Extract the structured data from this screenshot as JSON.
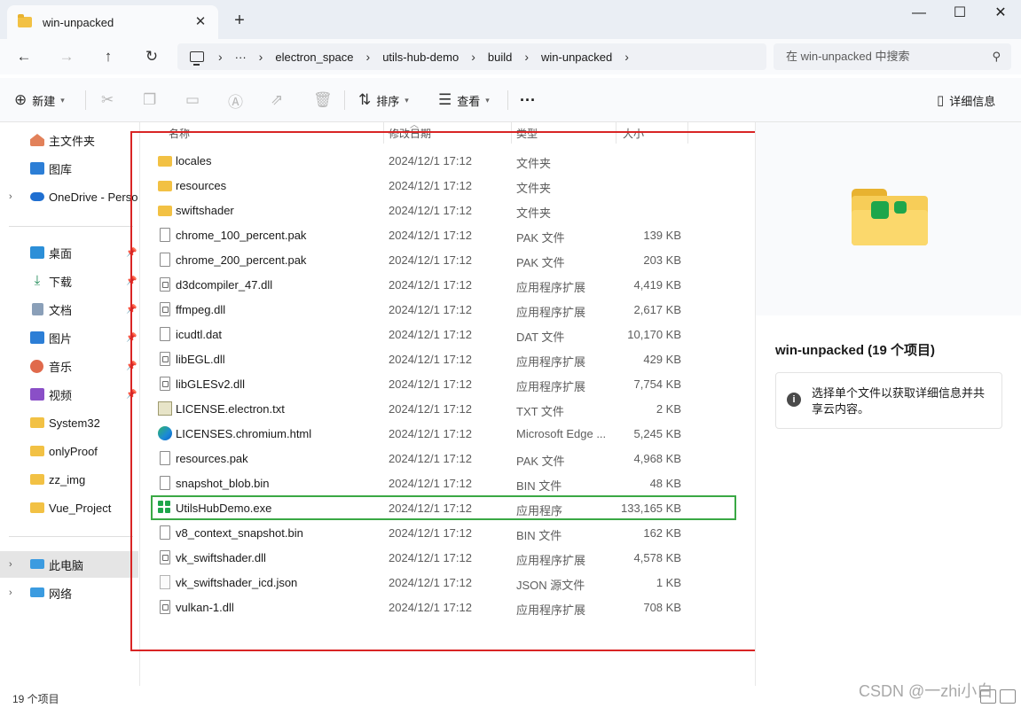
{
  "window": {
    "tab_title": "win-unpacked",
    "new_tab_label": "+",
    "tab_close_label": "✕",
    "minimize_label": "—",
    "maximize_label": "☐",
    "close_label": "✕"
  },
  "nav": {
    "back_label": "←",
    "forward_label": "→",
    "up_label": "↑",
    "refresh_label": "↻",
    "overflow_label": "···",
    "breadcrumbs": [
      "electron_space",
      "utils-hub-demo",
      "build",
      "win-unpacked"
    ],
    "search_placeholder": "在 win-unpacked 中搜索",
    "search_icon": "⚲"
  },
  "toolbar": {
    "new_label": "新建",
    "sort_label": "排序",
    "view_label": "查看",
    "more_label": "···",
    "details_label": "详细信息"
  },
  "sidebar": {
    "items": [
      {
        "label": "主文件夹",
        "icon": "home-icon"
      },
      {
        "label": "图库",
        "icon": "gallery-icon"
      },
      {
        "label": "OneDrive - Perso",
        "icon": "onedrive-icon"
      },
      {
        "label": "桌面",
        "icon": "desktop-icon"
      },
      {
        "label": "下载",
        "icon": "download-icon"
      },
      {
        "label": "文档",
        "icon": "documents-icon"
      },
      {
        "label": "图片",
        "icon": "pictures-icon"
      },
      {
        "label": "音乐",
        "icon": "music-icon"
      },
      {
        "label": "视频",
        "icon": "videos-icon"
      },
      {
        "label": "System32",
        "icon": "folder-icon"
      },
      {
        "label": "onlyProof",
        "icon": "folder-icon"
      },
      {
        "label": "zz_img",
        "icon": "folder-icon"
      },
      {
        "label": "Vue_Project",
        "icon": "folder-icon"
      },
      {
        "label": "此电脑",
        "icon": "this-pc-icon"
      },
      {
        "label": "网络",
        "icon": "network-icon"
      }
    ]
  },
  "columns": {
    "name": "名称",
    "modified": "修改日期",
    "type": "类型",
    "size": "大小"
  },
  "files": [
    {
      "name": "locales",
      "date": "2024/12/1 17:12",
      "type": "文件夹",
      "size": "",
      "icon": "folder"
    },
    {
      "name": "resources",
      "date": "2024/12/1 17:12",
      "type": "文件夹",
      "size": "",
      "icon": "folder"
    },
    {
      "name": "swiftshader",
      "date": "2024/12/1 17:12",
      "type": "文件夹",
      "size": "",
      "icon": "folder"
    },
    {
      "name": "chrome_100_percent.pak",
      "date": "2024/12/1 17:12",
      "type": "PAK 文件",
      "size": "139 KB",
      "icon": "file"
    },
    {
      "name": "chrome_200_percent.pak",
      "date": "2024/12/1 17:12",
      "type": "PAK 文件",
      "size": "203 KB",
      "icon": "file"
    },
    {
      "name": "d3dcompiler_47.dll",
      "date": "2024/12/1 17:12",
      "type": "应用程序扩展",
      "size": "4,419 KB",
      "icon": "dll"
    },
    {
      "name": "ffmpeg.dll",
      "date": "2024/12/1 17:12",
      "type": "应用程序扩展",
      "size": "2,617 KB",
      "icon": "dll"
    },
    {
      "name": "icudtl.dat",
      "date": "2024/12/1 17:12",
      "type": "DAT 文件",
      "size": "10,170 KB",
      "icon": "file"
    },
    {
      "name": "libEGL.dll",
      "date": "2024/12/1 17:12",
      "type": "应用程序扩展",
      "size": "429 KB",
      "icon": "dll"
    },
    {
      "name": "libGLESv2.dll",
      "date": "2024/12/1 17:12",
      "type": "应用程序扩展",
      "size": "7,754 KB",
      "icon": "dll"
    },
    {
      "name": "LICENSE.electron.txt",
      "date": "2024/12/1 17:12",
      "type": "TXT 文件",
      "size": "2 KB",
      "icon": "txt"
    },
    {
      "name": "LICENSES.chromium.html",
      "date": "2024/12/1 17:12",
      "type": "Microsoft Edge ...",
      "size": "5,245 KB",
      "icon": "edge"
    },
    {
      "name": "resources.pak",
      "date": "2024/12/1 17:12",
      "type": "PAK 文件",
      "size": "4,968 KB",
      "icon": "file"
    },
    {
      "name": "snapshot_blob.bin",
      "date": "2024/12/1 17:12",
      "type": "BIN 文件",
      "size": "48 KB",
      "icon": "file"
    },
    {
      "name": "UtilsHubDemo.exe",
      "date": "2024/12/1 17:12",
      "type": "应用程序",
      "size": "133,165 KB",
      "icon": "app"
    },
    {
      "name": "v8_context_snapshot.bin",
      "date": "2024/12/1 17:12",
      "type": "BIN 文件",
      "size": "162 KB",
      "icon": "file"
    },
    {
      "name": "vk_swiftshader.dll",
      "date": "2024/12/1 17:12",
      "type": "应用程序扩展",
      "size": "4,578 KB",
      "icon": "dll"
    },
    {
      "name": "vk_swiftshader_icd.json",
      "date": "2024/12/1 17:12",
      "type": "JSON 源文件",
      "size": "1 KB",
      "icon": "json"
    },
    {
      "name": "vulkan-1.dll",
      "date": "2024/12/1 17:12",
      "type": "应用程序扩展",
      "size": "708 KB",
      "icon": "dll"
    }
  ],
  "details": {
    "title": "win-unpacked (19 个项目)",
    "info_text": "选择单个文件以获取详细信息并共享云内容。"
  },
  "status": {
    "item_count": "19 个项目"
  },
  "watermark": "CSDN @一zhi小白",
  "colors": {
    "annotation_red": "#d92525",
    "highlight_green": "#3aa845",
    "folder_yellow": "#f2c144",
    "app_green": "#1ea64b"
  }
}
